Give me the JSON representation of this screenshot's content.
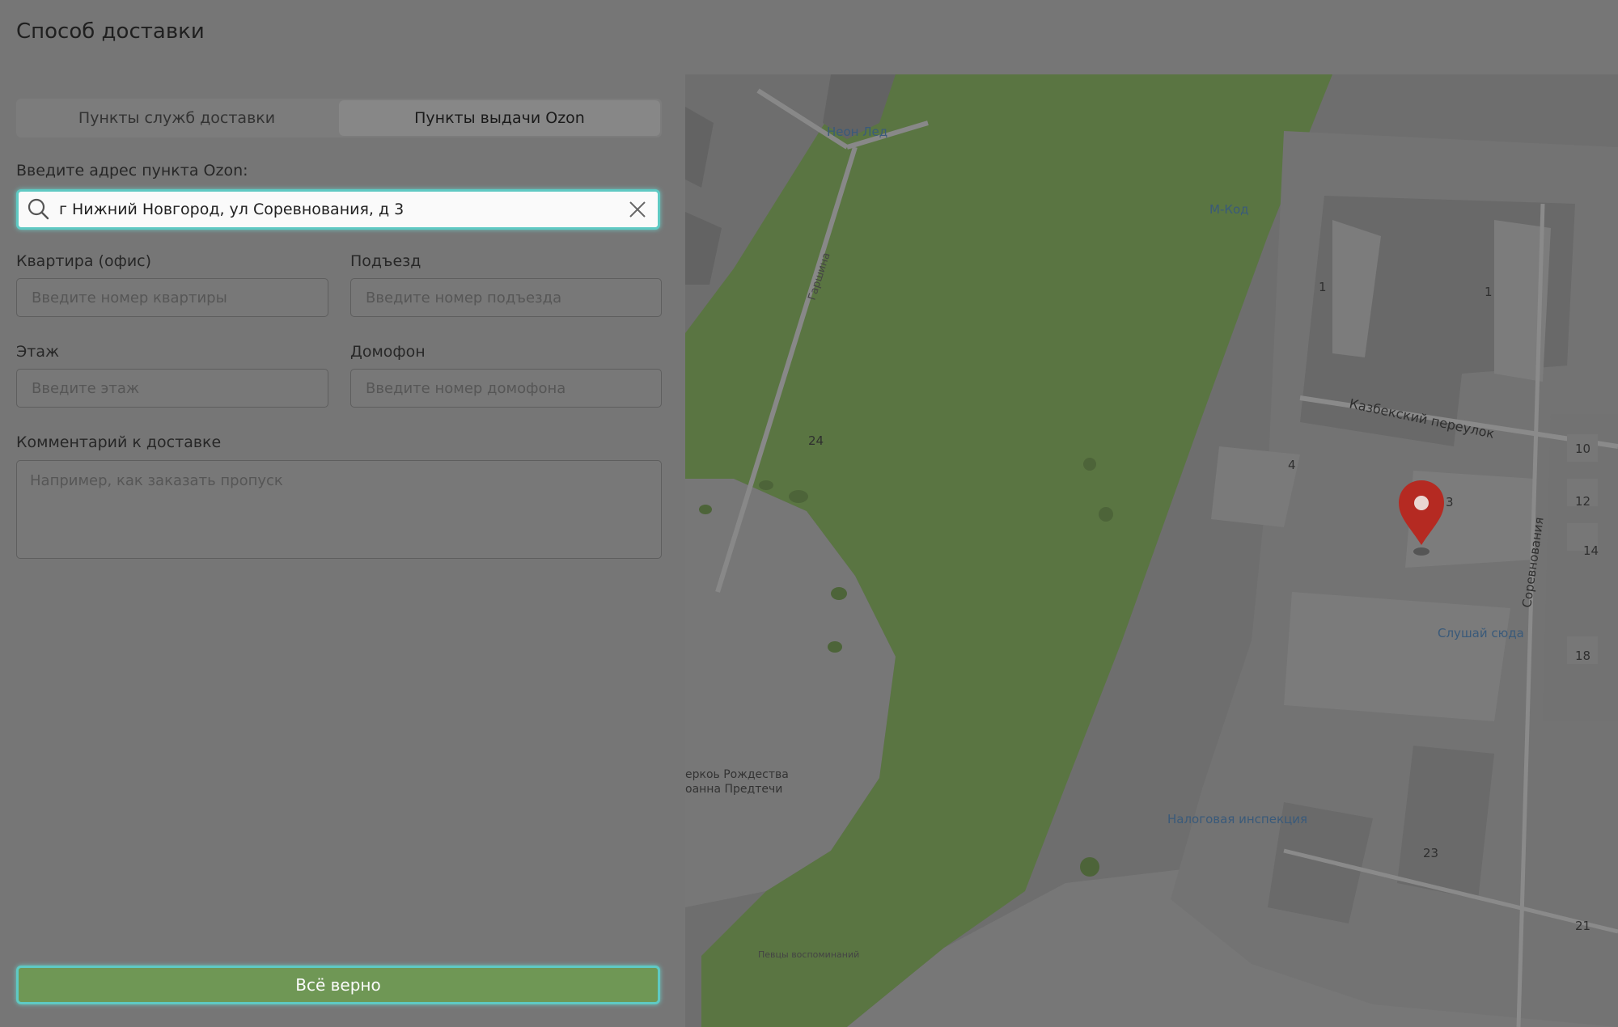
{
  "page": {
    "title": "Способ доставки"
  },
  "tabs": [
    {
      "label": "Пункты служб доставки",
      "active": false
    },
    {
      "label": "Пункты выдачи Ozon",
      "active": true
    }
  ],
  "address": {
    "label": "Введите адрес пункта Ozon:",
    "value": "г Нижний Новгород, ул Соревнования, д 3",
    "search_icon": "search-icon",
    "clear_icon": "close-icon"
  },
  "fields": {
    "apartment": {
      "label": "Квартира (офис)",
      "placeholder": "Введите номер квартиры"
    },
    "entrance": {
      "label": "Подъезд",
      "placeholder": "Введите номер подъезда"
    },
    "floor": {
      "label": "Этаж",
      "placeholder": "Введите этаж"
    },
    "intercom": {
      "label": "Домофон",
      "placeholder": "Введите номер домофона"
    },
    "comment": {
      "label": "Комментарий к доставке",
      "placeholder": "Например, как заказать пропуск"
    }
  },
  "confirm_button": {
    "label": "Всё верно"
  },
  "map": {
    "labels": {
      "neon_led": "Неон Лед",
      "m_kod": "М-Код",
      "garshina": "Гаршина",
      "kazbek": "Казбекский переулок",
      "sorevnovaniya": "Соревнования",
      "slushay": "Слушай сюда",
      "nalog": "Налоговая инспекция",
      "church1": "еркоь Рождества",
      "church2": "оанна Предтечи",
      "memorial": "Певцы воспоминаний"
    },
    "numbers": {
      "n1a": "1",
      "n1b": "1",
      "n4": "4",
      "n3": "3",
      "n24": "24",
      "n10": "10",
      "n12": "12",
      "n14": "14",
      "n18": "18",
      "n23": "23",
      "n21": "21"
    },
    "marker_color": "#b52a22",
    "park_color": "#5a7542"
  }
}
